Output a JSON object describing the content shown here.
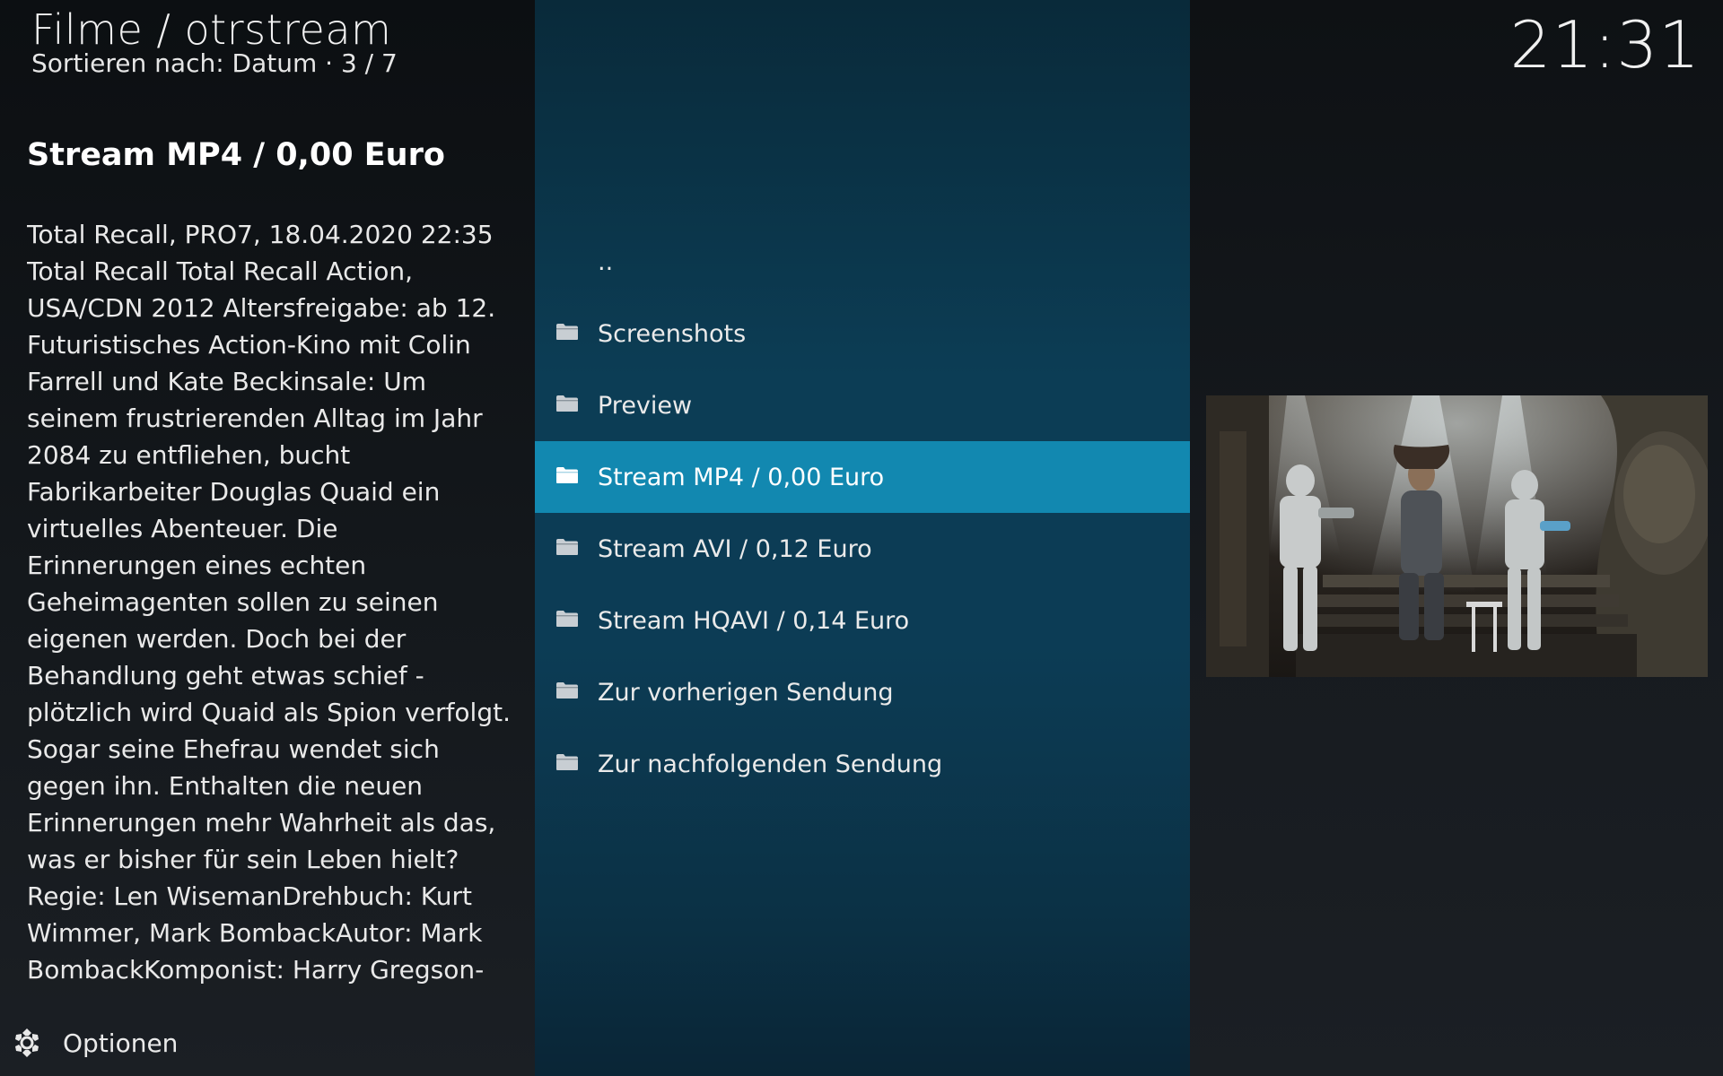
{
  "header": {
    "title": "Filme / otrstream",
    "subtitle": "Sortieren nach: Datum  ·  3 / 7"
  },
  "clock": "21:31",
  "detail": {
    "title": "Stream MP4 / 0,00 Euro",
    "plot": "Total Recall, PRO7, 18.04.2020 22:35 Total Recall Total Recall Action, USA/CDN 2012 Altersfreigabe: ab 12. Futuristisches Action-Kino mit Colin Farrell und Kate Beckinsale: Um seinem frustrierenden Alltag im Jahr 2084 zu entfliehen, bucht Fabrikarbeiter Douglas Quaid ein virtuelles Abenteuer. Die Erinnerungen eines echten Geheimagenten sollen zu seinen eigenen werden. Doch bei der Behandlung geht etwas schief - plötzlich wird Quaid als Spion verfolgt. Sogar seine Ehefrau wendet sich gegen ihn. Enthalten die neuen Erinnerungen mehr Wahrheit als das, was er bisher für sein Leben hielt?Regie: Len WisemanDrehbuch: Kurt Wimmer, Mark BombackAutor: Mark BombackKomponist: Harry Gregson-WilliamsKamera: Paul"
  },
  "options": {
    "label": "Optionen",
    "icon": "gear-icon"
  },
  "list": {
    "items": [
      {
        "label": "..",
        "icon": "none",
        "selected": false
      },
      {
        "label": "Screenshots",
        "icon": "folder-icon",
        "selected": false
      },
      {
        "label": "Preview",
        "icon": "folder-icon",
        "selected": false
      },
      {
        "label": "Stream MP4 / 0,00 Euro",
        "icon": "folder-icon",
        "selected": true
      },
      {
        "label": "Stream AVI / 0,12 Euro",
        "icon": "folder-icon",
        "selected": false
      },
      {
        "label": "Stream HQAVI / 0,14 Euro",
        "icon": "folder-icon",
        "selected": false
      },
      {
        "label": "Zur vorherigen Sendung",
        "icon": "folder-icon",
        "selected": false
      },
      {
        "label": "Zur nachfolgenden Sendung",
        "icon": "folder-icon",
        "selected": false
      }
    ]
  },
  "colors": {
    "selected": "#1288b0",
    "center_panel": "#0c3d55"
  }
}
